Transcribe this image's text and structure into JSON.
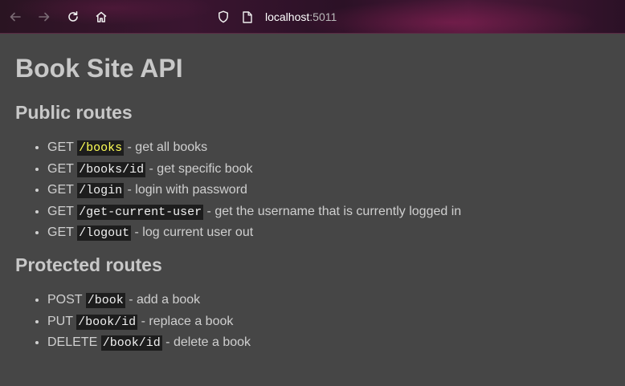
{
  "browser": {
    "url_host": "localhost",
    "url_port": ":5011"
  },
  "page": {
    "title": "Book Site API",
    "public_heading": "Public routes",
    "public_routes": [
      {
        "method": "GET",
        "path": "/books",
        "desc": "- get all books"
      },
      {
        "method": "GET",
        "path": "/books/id",
        "desc": "- get specific book"
      },
      {
        "method": "GET",
        "path": "/login",
        "desc": "- login with password"
      },
      {
        "method": "GET",
        "path": "/get-current-user",
        "desc": "- get the username that is currently logged in"
      },
      {
        "method": "GET",
        "path": "/logout",
        "desc": "- log current user out"
      }
    ],
    "protected_heading": "Protected routes",
    "protected_routes": [
      {
        "method": "POST",
        "path": "/book",
        "desc": "- add a book"
      },
      {
        "method": "PUT",
        "path": "/book/id",
        "desc": "- replace a book"
      },
      {
        "method": "DELETE",
        "path": "/book/id",
        "desc": "- delete a book"
      }
    ]
  },
  "icons": [
    "back-arrow-icon",
    "forward-arrow-icon",
    "reload-icon",
    "home-icon",
    "shield-icon",
    "page-icon"
  ],
  "colors": {
    "page_bg": "#464646",
    "code_bg": "#1d1d1d",
    "code_highlight": "#ffff55"
  }
}
